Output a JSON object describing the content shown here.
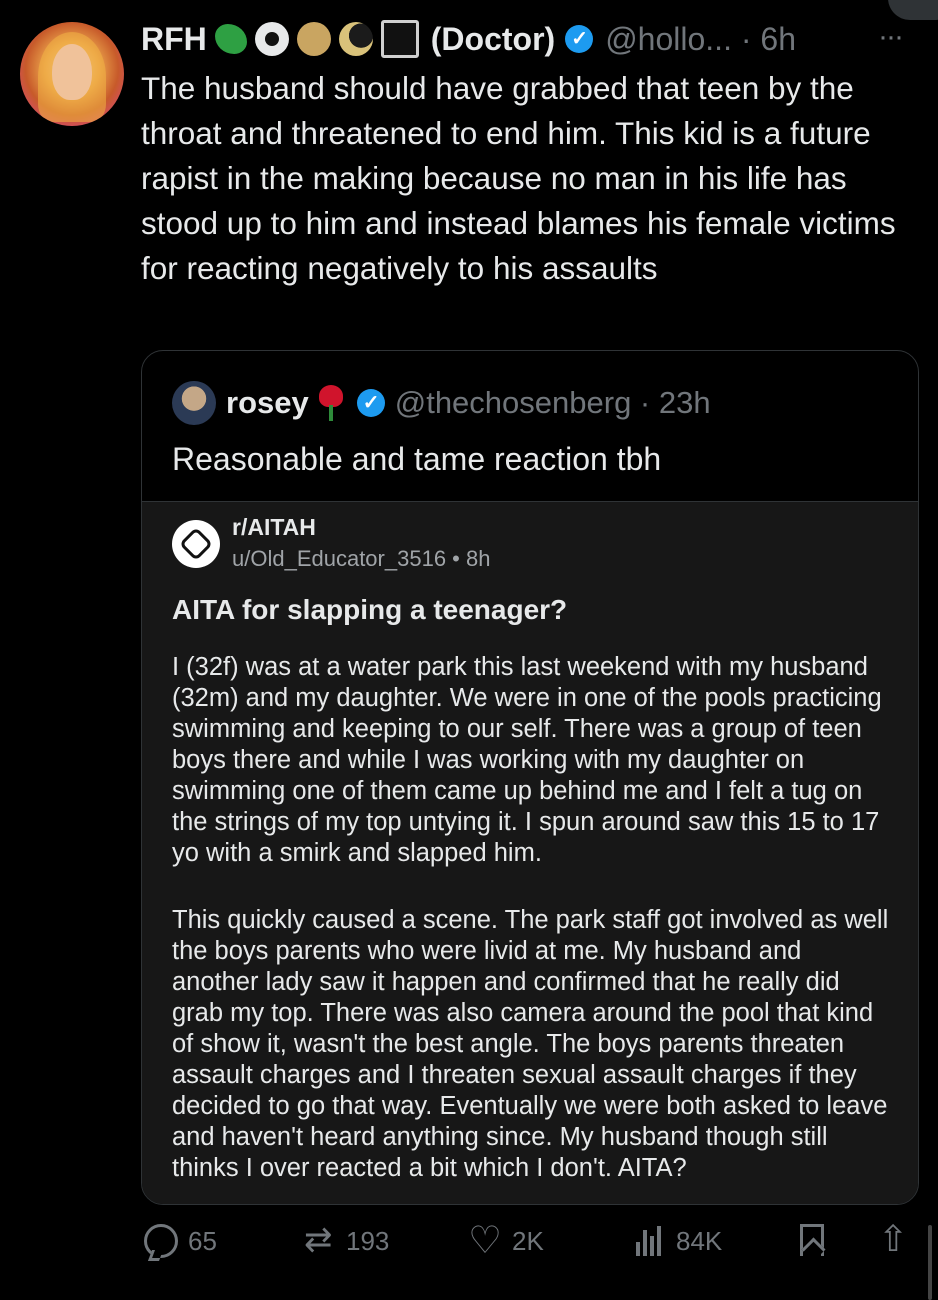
{
  "tweet": {
    "author_name": "RFH",
    "name_suffix": "(Doctor)",
    "handle_time": "@hollo... · 6h",
    "more_label": "···",
    "text": "The husband should have grabbed that teen by the throat and threatened to end him. This kid is a future rapist in the making because no man in his life has stood up to him and instead blames his female victims for reacting negatively to his assaults"
  },
  "quote": {
    "author_name": "rosey",
    "handle_time": "@thechosenberg · 23h",
    "text": "Reasonable and tame reaction tbh"
  },
  "reddit": {
    "subreddit": "r/AITAH",
    "meta": "u/Old_Educator_3516 • 8h",
    "title": "AITA for slapping a teenager?",
    "paragraph1": "I (32f) was at a water park this last weekend with my husband (32m) and my daughter. We were in one of the pools practicing swimming and keeping to our self. There was a group of teen boys there and while I was working with my daughter on swimming one of them came up behind me and I felt a tug on the strings of my top untying it. I spun around saw this 15 to 17 yo with a smirk and slapped him.",
    "paragraph2": "This quickly caused a scene. The park staff got involved as well the boys parents who were livid at me. My husband and another lady saw it happen and confirmed that he really did grab my top. There was also camera around the pool that kind of show it, wasn't the best angle. The boys parents threaten assault charges and I threaten sexual assault charges if they decided to go that way. Eventually we were both asked to leave and haven't heard anything since. My husband though still thinks I over reacted a bit which I don't. AITA?"
  },
  "actions": {
    "replies": "65",
    "retweets": "193",
    "likes": "2K",
    "views": "84K"
  },
  "colors": {
    "background": "#000000",
    "text": "#e7e9ea",
    "muted": "#71767b",
    "verified": "#1d9bf0",
    "reddit_card": "#171717"
  }
}
